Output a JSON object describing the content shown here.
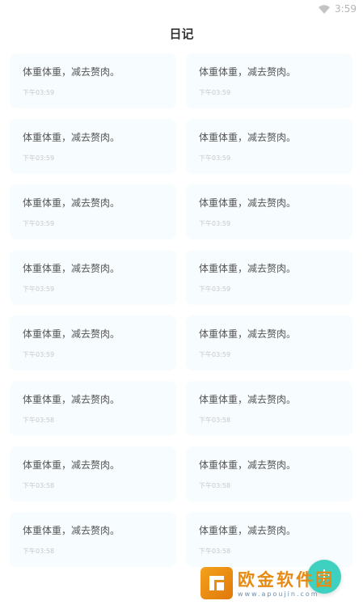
{
  "status_bar": {
    "time": "3:59"
  },
  "header": {
    "title": "日记"
  },
  "entries": [
    {
      "text": "体重体重，减去赘肉。",
      "time": "下午03:59"
    },
    {
      "text": "体重体重，减去赘肉。",
      "time": "下午03:59"
    },
    {
      "text": "体重体重，减去赘肉。",
      "time": "下午03:59"
    },
    {
      "text": "体重体重，减去赘肉。",
      "time": "下午03:59"
    },
    {
      "text": "体重体重，减去赘肉。",
      "time": "下午03:59"
    },
    {
      "text": "体重体重，减去赘肉。",
      "time": "下午03:59"
    },
    {
      "text": "体重体重，减去赘肉。",
      "time": "下午03:59"
    },
    {
      "text": "体重体重，减去赘肉。",
      "time": "下午03:59"
    },
    {
      "text": "体重体重，减去赘肉。",
      "time": "下午03:59"
    },
    {
      "text": "体重体重，减去赘肉。",
      "time": "下午03:59"
    },
    {
      "text": "体重体重，减去赘肉。",
      "time": "下午03:58"
    },
    {
      "text": "体重体重，减去赘肉。",
      "time": "下午03:58"
    },
    {
      "text": "体重体重，减去赘肉。",
      "time": "下午03:58"
    },
    {
      "text": "体重体重，减去赘肉。",
      "time": "下午03:58"
    },
    {
      "text": "体重体重，减去赘肉。",
      "time": "下午03:58"
    },
    {
      "text": "体重体重，减去赘肉。",
      "time": "下午03:58"
    }
  ],
  "fab": {
    "icon": "add-icon",
    "color": "#3ed1bf"
  },
  "watermark": {
    "name": "欧金软件园",
    "url": "www.apoujin.com"
  },
  "colors": {
    "card_bg": "#f7fcfe",
    "accent": "#3ed1bf",
    "watermark": "#e68a12"
  }
}
